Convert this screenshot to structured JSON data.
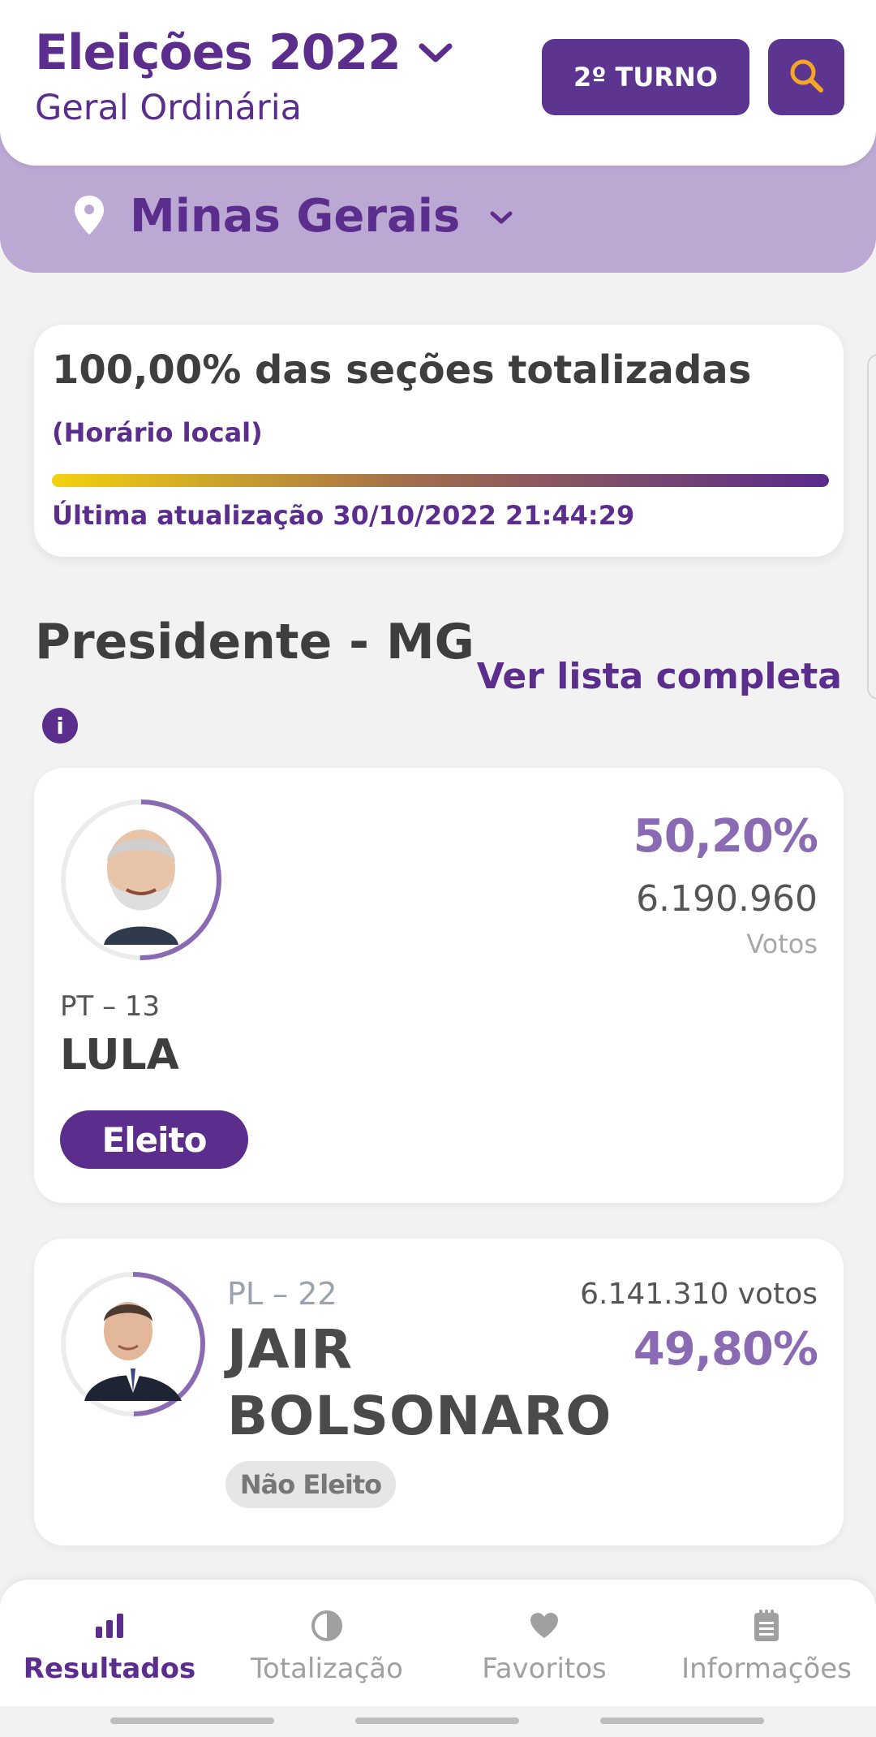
{
  "header": {
    "title": "Eleições 2022",
    "subtitle": "Geral Ordinária",
    "turno_button": "2º TURNO",
    "search_icon": "search-icon",
    "title_chevron_icon": "chevron-down-icon"
  },
  "state": {
    "name": "Minas Gerais",
    "pin_icon": "location-pin-icon",
    "chevron_icon": "chevron-down-icon"
  },
  "status": {
    "title": "100,00% das seções totalizadas",
    "local_time_label": "(Horário local)",
    "progress_fraction": 1.0,
    "last_update": "Última atualização 30/10/2022 21:44:29"
  },
  "section": {
    "title": "Presidente - MG",
    "see_full_list": "Ver lista completa",
    "info_icon": "i"
  },
  "candidates": [
    {
      "party": "PT – 13",
      "name": "LULA",
      "percent": "50,20%",
      "votes": "6.190.960",
      "votes_label": "Votos",
      "status": "Eleito",
      "ring_fraction": 0.502
    },
    {
      "party": "PL – 22",
      "name_line1": "JAIR",
      "name_line2": "BOLSONARO",
      "percent": "49,80%",
      "votes": "6.141.310 votos",
      "status": "Não Eleito",
      "ring_fraction": 0.498
    }
  ],
  "bottom_nav": [
    {
      "label": "Resultados",
      "icon": "bar-chart-icon",
      "active": true
    },
    {
      "label": "Totalização",
      "icon": "pie-chart-icon",
      "active": false
    },
    {
      "label": "Favoritos",
      "icon": "heart-icon",
      "active": false
    },
    {
      "label": "Informações",
      "icon": "clipboard-icon",
      "active": false
    }
  ],
  "colors": {
    "primary": "#5b2d8c",
    "state_bar": "#bba8d3",
    "percent": "#8a6bb3",
    "search_icon": "#f5a623"
  }
}
